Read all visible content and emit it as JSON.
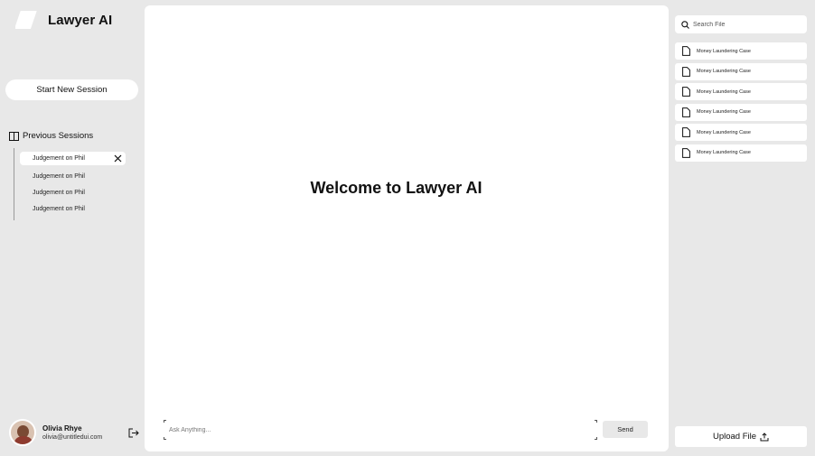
{
  "app": {
    "name": "Lawyer AI"
  },
  "sidebar": {
    "new_session_label": "Start New Session",
    "previous_sessions_label": "Previous Sessions",
    "sessions": [
      {
        "label": "Judgement on Phil",
        "active": true
      },
      {
        "label": "Judgement on Phil",
        "active": false
      },
      {
        "label": "Judgement on Phil",
        "active": false
      },
      {
        "label": "Judgement on Phil",
        "active": false
      }
    ]
  },
  "user": {
    "name": "Olivia Rhye",
    "email": "olivia@untitledui.com"
  },
  "chat": {
    "welcome": "Welcome to Lawyer AI",
    "input_placeholder": "Ask Anything...",
    "send_label": "Send"
  },
  "files_panel": {
    "search_placeholder": "Search File",
    "files": [
      "Money Laundering Case",
      "Money Laundering Case",
      "Money Laundering Case",
      "Money Laundering Case",
      "Money Laundering Case",
      "Money Laundering Case"
    ],
    "upload_label": "Upload File"
  }
}
